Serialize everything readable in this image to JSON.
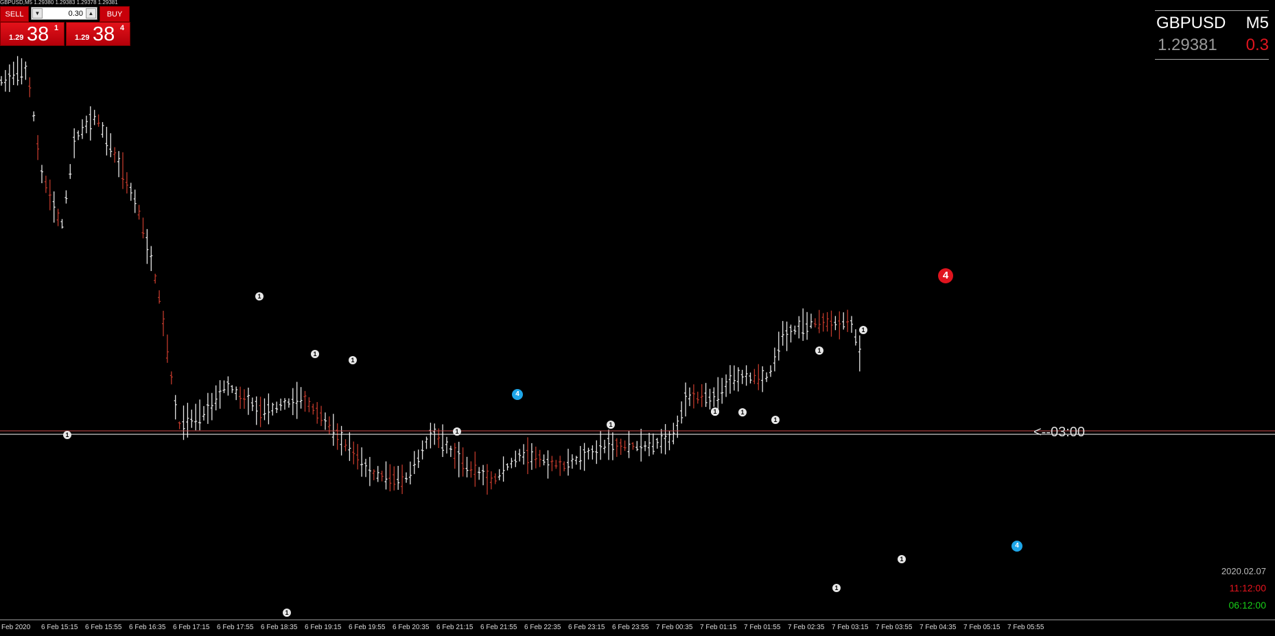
{
  "window": {
    "title": "GBPUSD,M5  1.29380 1.29383 1.29378 1.29381"
  },
  "trade_panel": {
    "sell_label": "SELL",
    "buy_label": "BUY",
    "lot_value": "0.30",
    "sell_price_small": "1.29",
    "sell_price_big": "38",
    "sell_price_sup": "1",
    "buy_price_small": "1.29",
    "buy_price_big": "38",
    "buy_price_sup": "4"
  },
  "symbol_info": {
    "symbol": "GBPUSD",
    "timeframe": "M5",
    "price": "1.29381",
    "spread": "0.3"
  },
  "timer_label": "<--03:00",
  "clock": {
    "date": "2020.02.07",
    "time1": "11:12:00",
    "time2": "06:12:00"
  },
  "colors": {
    "bull": "#e8e8e8",
    "bear": "#c0392b",
    "bid_line": "#ffffff",
    "ask_line": "#d05050"
  },
  "x_axis_labels": [
    "Feb 2020",
    "6 Feb 15:15",
    "6 Feb 15:55",
    "6 Feb 16:35",
    "6 Feb 17:15",
    "6 Feb 17:55",
    "6 Feb 18:35",
    "6 Feb 19:15",
    "6 Feb 19:55",
    "6 Feb 20:35",
    "6 Feb 21:15",
    "6 Feb 21:55",
    "6 Feb 22:35",
    "6 Feb 23:15",
    "6 Feb 23:55",
    "7 Feb 00:35",
    "7 Feb 01:15",
    "7 Feb 01:55",
    "7 Feb 02:35",
    "7 Feb 03:15",
    "7 Feb 03:55",
    "7 Feb 04:35",
    "7 Feb 05:15",
    "7 Feb 05:55"
  ],
  "markers": [
    {
      "label": "1",
      "kind": "white"
    },
    {
      "label": "1",
      "kind": "white"
    },
    {
      "label": "1",
      "kind": "white"
    },
    {
      "label": "1",
      "kind": "white"
    },
    {
      "label": "1",
      "kind": "white"
    },
    {
      "label": "1",
      "kind": "white"
    },
    {
      "label": "1",
      "kind": "white"
    },
    {
      "label": "1",
      "kind": "white"
    },
    {
      "label": "1",
      "kind": "white"
    },
    {
      "label": "1",
      "kind": "white"
    },
    {
      "label": "1",
      "kind": "white"
    },
    {
      "label": "1",
      "kind": "white"
    },
    {
      "label": "1",
      "kind": "white"
    },
    {
      "label": "1",
      "kind": "white"
    },
    {
      "label": "1",
      "kind": "white"
    },
    {
      "label": "4",
      "kind": "blue"
    },
    {
      "label": "4",
      "kind": "blue"
    },
    {
      "label": "4",
      "kind": "red"
    }
  ]
}
